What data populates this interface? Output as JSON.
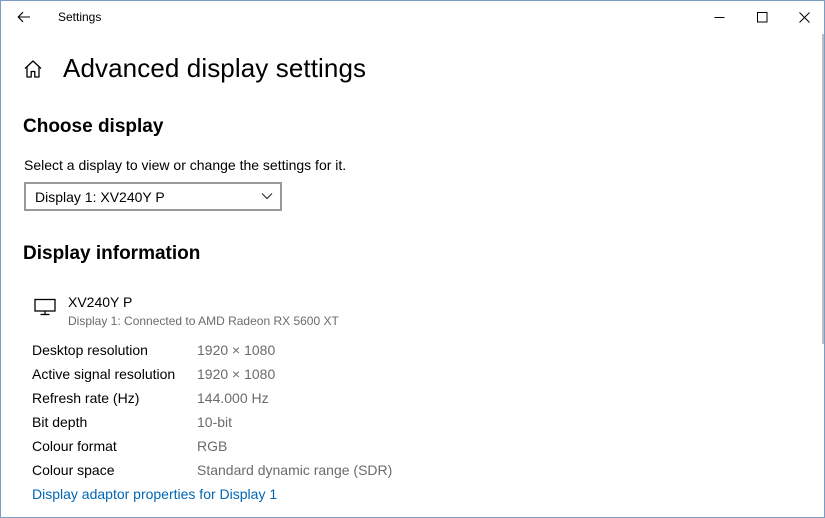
{
  "window": {
    "app_title": "Settings",
    "icons": {
      "back": "back-arrow-icon",
      "minimize": "minimize-icon",
      "maximize": "maximize-icon",
      "close": "close-icon"
    }
  },
  "page": {
    "home_icon": "home-icon",
    "title": "Advanced display settings"
  },
  "choose_display": {
    "heading": "Choose display",
    "select_label": "Select a display to view or change the settings for it.",
    "selected_display": "Display 1: XV240Y P"
  },
  "display_information": {
    "heading": "Display information",
    "monitor_icon": "monitor-icon",
    "monitor_name": "XV240Y P",
    "monitor_connection": "Display 1: Connected to AMD Radeon RX 5600 XT",
    "rows": [
      {
        "label": "Desktop resolution",
        "value": "1920 × 1080"
      },
      {
        "label": "Active signal resolution",
        "value": "1920 × 1080"
      },
      {
        "label": "Refresh rate (Hz)",
        "value": "144.000 Hz"
      },
      {
        "label": "Bit depth",
        "value": "10-bit"
      },
      {
        "label": "Colour format",
        "value": "RGB"
      },
      {
        "label": "Colour space",
        "value": "Standard dynamic range (SDR)"
      }
    ],
    "adapter_link": "Display adaptor properties for Display 1"
  },
  "colors": {
    "link": "#0066b4",
    "secondary_text": "#6b6b6b",
    "window_border": "#7a9cc7"
  }
}
